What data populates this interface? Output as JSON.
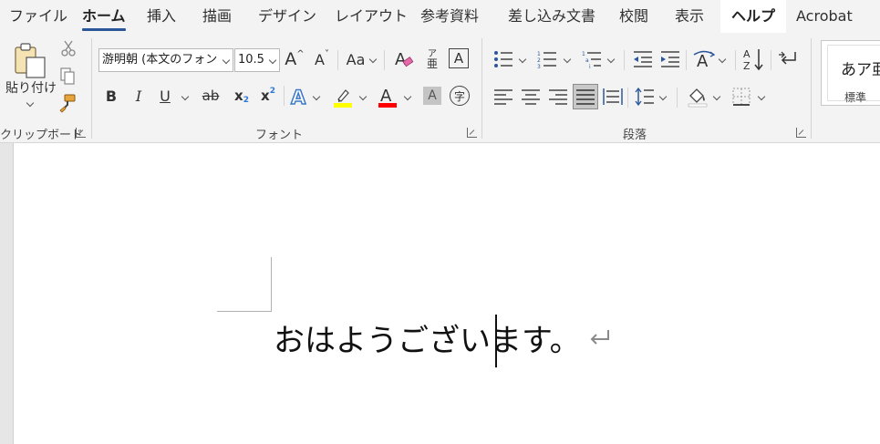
{
  "tabs": [
    {
      "id": "file",
      "label": "ファイル"
    },
    {
      "id": "home",
      "label": "ホーム",
      "active": true
    },
    {
      "id": "insert",
      "label": "挿入"
    },
    {
      "id": "draw",
      "label": "描画"
    },
    {
      "id": "design",
      "label": "デザイン"
    },
    {
      "id": "layout",
      "label": "レイアウト"
    },
    {
      "id": "references",
      "label": "参考資料"
    },
    {
      "id": "mailings",
      "label": "差し込み文書"
    },
    {
      "id": "review",
      "label": "校閲"
    },
    {
      "id": "view",
      "label": "表示"
    },
    {
      "id": "help",
      "label": "ヘルプ"
    },
    {
      "id": "acrobat",
      "label": "Acrobat"
    }
  ],
  "clipboard": {
    "paste_label": "貼り付け",
    "group_label": "クリップボード"
  },
  "font": {
    "font_name": "游明朝 (本文のフォン",
    "font_size": "10.5",
    "group_label": "フォント",
    "phonetic_top": "ア",
    "phonetic_bottom": "亜",
    "border_char": "A",
    "enclose_char": "字",
    "bold": "B",
    "italic": "I",
    "underline": "U",
    "strike": "ab",
    "subscript_base": "x",
    "subscript_mark": "2",
    "superscript_base": "x",
    "superscript_mark": "2",
    "grow": "A",
    "shrink": "A",
    "case": "Aa",
    "highlight_color": "#ffff00",
    "font_color": "#ff0000"
  },
  "paragraph": {
    "group_label": "段落"
  },
  "styles": {
    "sample": "あア亜",
    "name": "標準"
  },
  "document": {
    "text_before_caret": "おはようござい",
    "text_after_caret": "ます。"
  },
  "colors": {
    "accent": "#2b579a",
    "ribbon_bg": "#f3f3f3",
    "text_effect_blue": "#3b78c8"
  }
}
